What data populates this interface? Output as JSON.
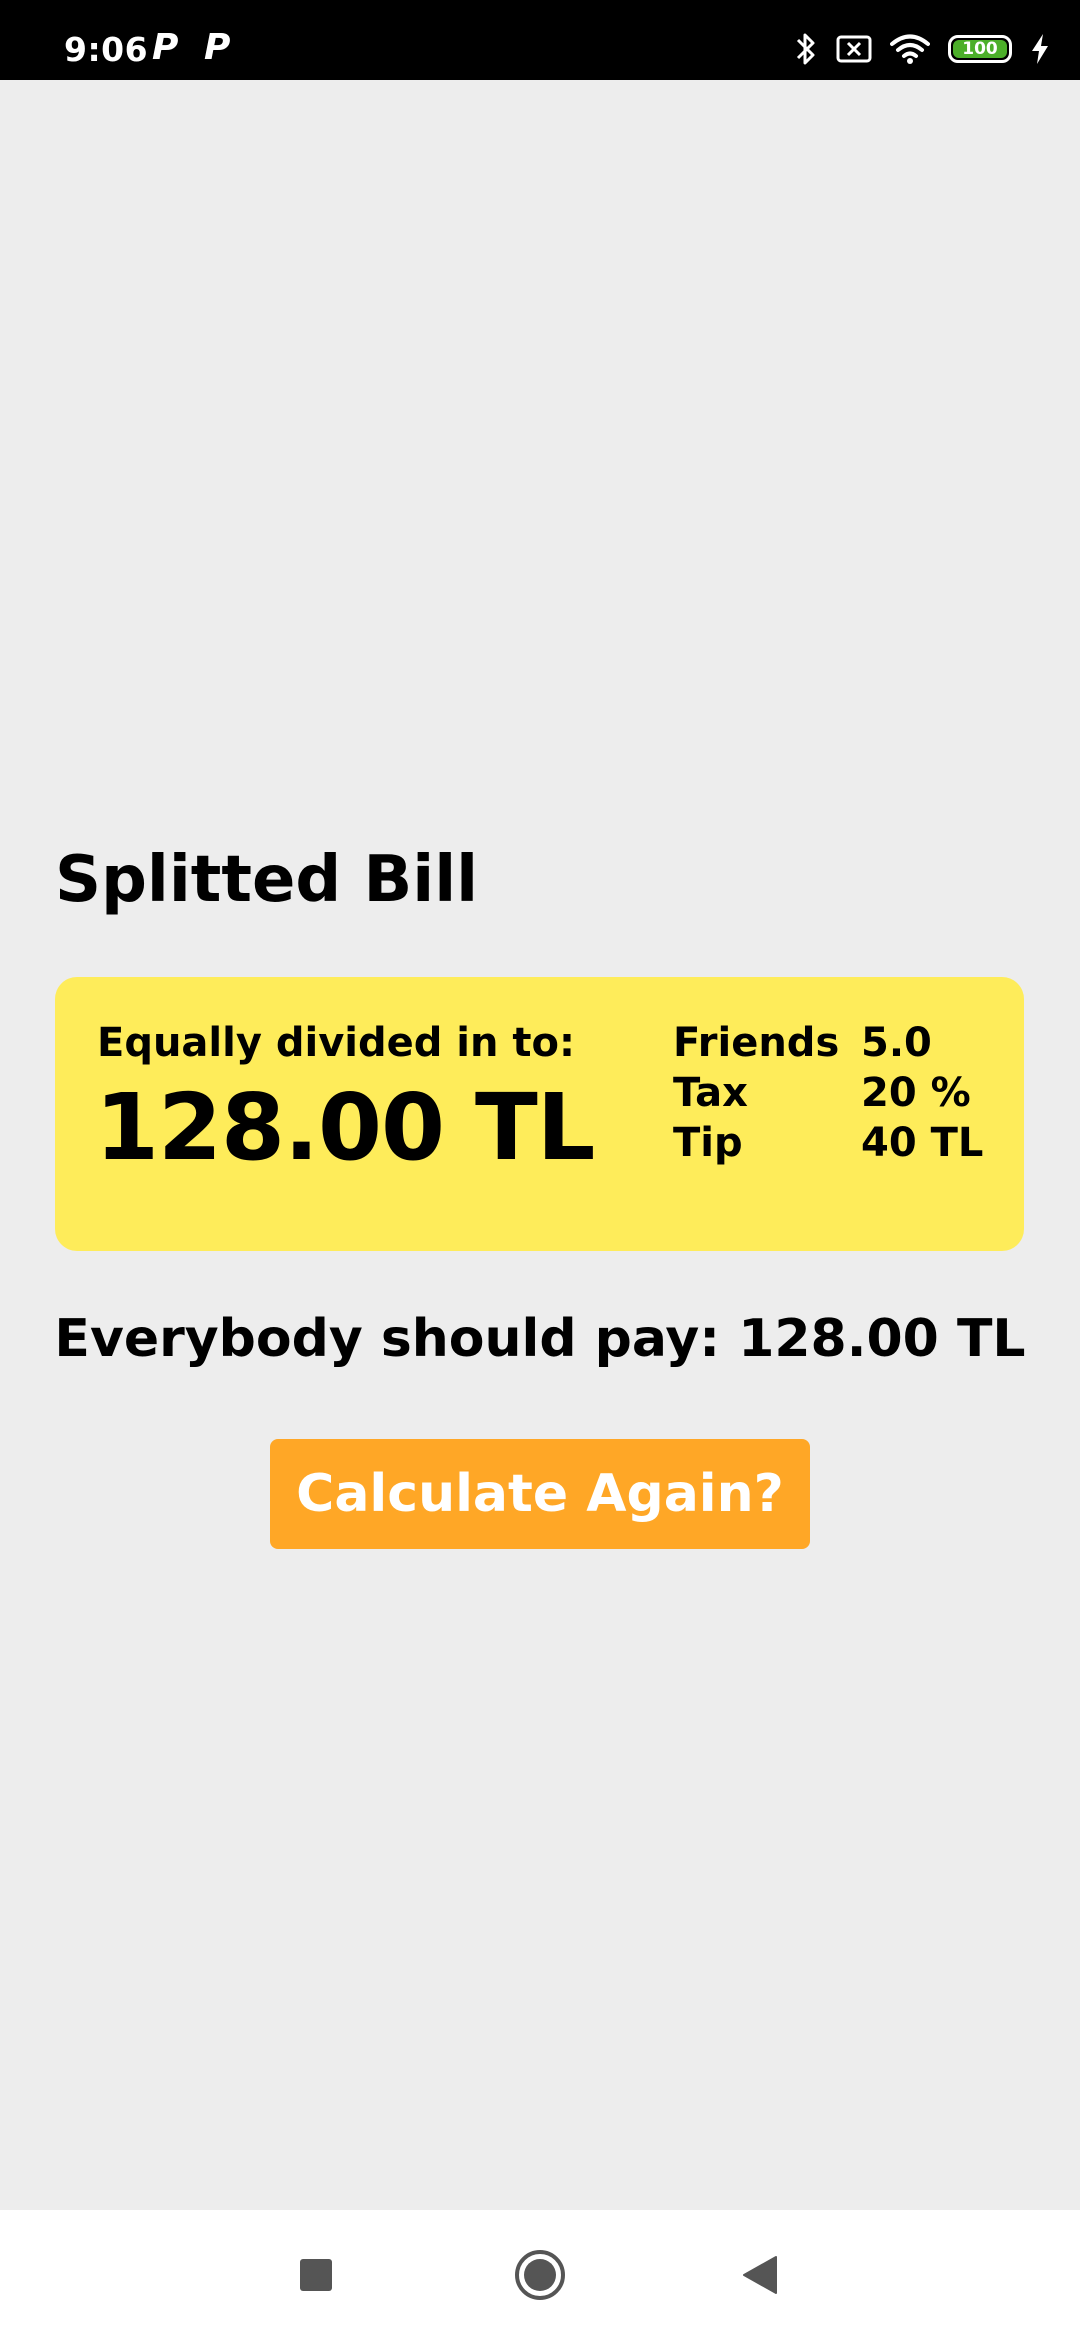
{
  "status_bar": {
    "time": "9:06",
    "notification_icons": [
      "P",
      "P"
    ],
    "icons": [
      "bluetooth-icon",
      "sim-card-icon",
      "wifi-icon",
      "battery-icon",
      "charging-icon"
    ],
    "battery_level": "100",
    "battery_color": "#4caf2a"
  },
  "main": {
    "title": "Splitted Bill",
    "card": {
      "label": "Equally divided in to:",
      "amount": "128.00 TL",
      "details": [
        {
          "label": "Friends",
          "value": "5.0"
        },
        {
          "label": "Tax",
          "value": "20 %"
        },
        {
          "label": "Tip",
          "value": "40 TL"
        }
      ],
      "background_color": "#feec5a"
    },
    "pay_text": "Everybody should pay: 128.00 TL",
    "button": {
      "label": "Calculate Again?",
      "color": "#ffa726"
    }
  },
  "nav_bar": {
    "icons": [
      "recents-square-icon",
      "home-circle-icon",
      "back-triangle-icon"
    ]
  }
}
